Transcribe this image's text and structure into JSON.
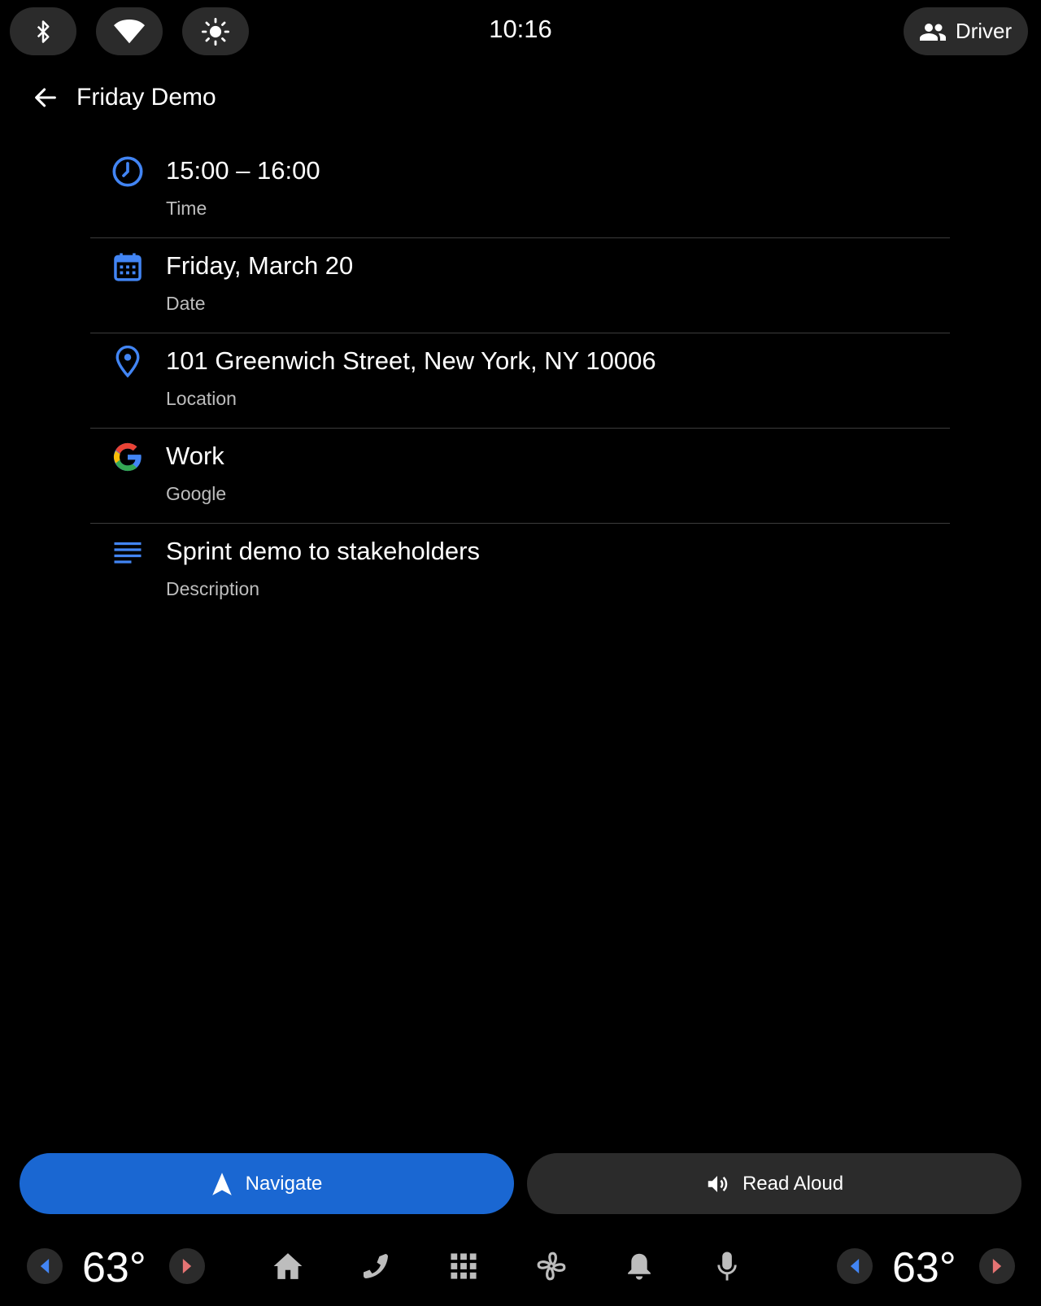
{
  "status_bar": {
    "clock": "10:16",
    "profile_label": "Driver"
  },
  "header": {
    "title": "Friday Demo"
  },
  "details": [
    {
      "icon": "clock-icon",
      "primary": "15:00 – 16:00",
      "secondary": "Time"
    },
    {
      "icon": "calendar-icon",
      "primary": "Friday, March 20",
      "secondary": "Date"
    },
    {
      "icon": "location-pin-icon",
      "primary": "101 Greenwich Street, New York, NY 10006",
      "secondary": "Location"
    },
    {
      "icon": "google-icon",
      "primary": "Work",
      "secondary": "Google"
    },
    {
      "icon": "description-icon",
      "primary": "Sprint demo to stakeholders",
      "secondary": "Description"
    }
  ],
  "actions": {
    "navigate_label": "Navigate",
    "read_aloud_label": "Read Aloud"
  },
  "climate": {
    "left_temp": "63°",
    "right_temp": "63°"
  },
  "colors": {
    "accent": "#1a67d2",
    "icon_blue": "#4285f4",
    "surface": "#2b2b2b",
    "background": "#000000"
  }
}
